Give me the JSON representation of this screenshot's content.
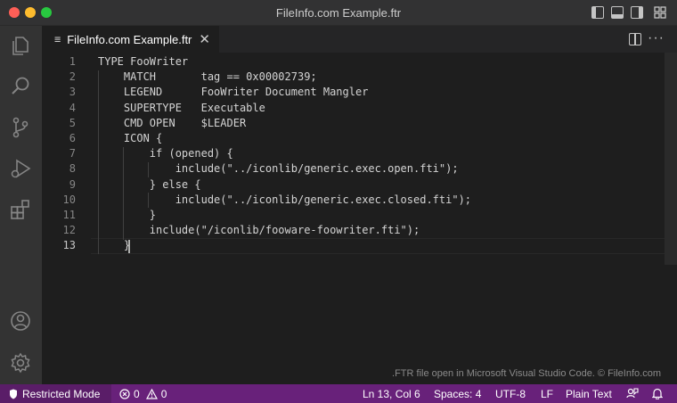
{
  "window": {
    "title": "FileInfo.com Example.ftr"
  },
  "tab": {
    "label": "FileInfo.com Example.ftr",
    "file_icon": "≡",
    "close_glyph": "✕"
  },
  "editor": {
    "lines": [
      {
        "number": "1",
        "text": "TYPE FooWriter"
      },
      {
        "number": "2",
        "text": "    MATCH       tag == 0x00002739;"
      },
      {
        "number": "3",
        "text": "    LEGEND      FooWriter Document Mangler"
      },
      {
        "number": "4",
        "text": "    SUPERTYPE   Executable"
      },
      {
        "number": "5",
        "text": "    CMD OPEN    $LEADER"
      },
      {
        "number": "6",
        "text": "    ICON {"
      },
      {
        "number": "7",
        "text": "        if (opened) {"
      },
      {
        "number": "8",
        "text": "            include(\"../iconlib/generic.exec.open.fti\");"
      },
      {
        "number": "9",
        "text": "        } else {"
      },
      {
        "number": "10",
        "text": "            include(\"../iconlib/generic.exec.closed.fti\");"
      },
      {
        "number": "11",
        "text": "        }"
      },
      {
        "number": "12",
        "text": "        include(\"/iconlib/fooware-foowriter.fti\");"
      },
      {
        "number": "13",
        "text": "    }"
      }
    ],
    "active_line": "13",
    "caption": ".FTR file open in Microsoft Visual Studio Code. © FileInfo.com"
  },
  "activity_bar": {
    "icons": [
      "explorer-icon",
      "search-icon",
      "source-control-icon",
      "run-debug-icon",
      "extensions-icon",
      "account-icon",
      "settings-gear-icon"
    ]
  },
  "statusbar": {
    "restricted_mode": "Restricted Mode",
    "errors": "0",
    "warnings": "0",
    "cursor_position": "Ln 13, Col 6",
    "spaces": "Spaces: 4",
    "encoding": "UTF-8",
    "eol": "LF",
    "language": "Plain Text",
    "colors": {
      "background": "#68217a",
      "restricted_background": "#5a1d68"
    }
  }
}
